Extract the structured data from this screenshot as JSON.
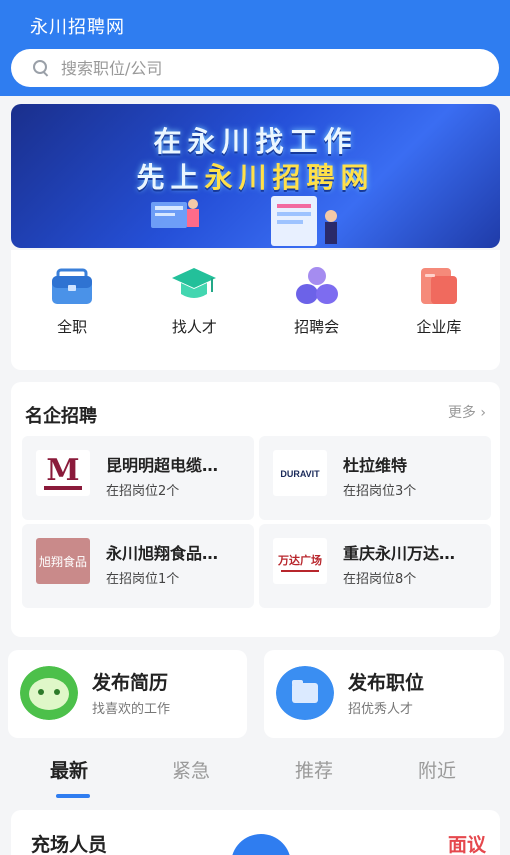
{
  "header": {
    "title": "永川招聘网"
  },
  "search": {
    "placeholder": "搜索职位/公司"
  },
  "banner": {
    "line1": "在永川找工作",
    "line2_prefix": "先上",
    "line2_highlight": "永川招聘网"
  },
  "quick_links": [
    {
      "label": "全职",
      "icon": "briefcase-icon"
    },
    {
      "label": "找人才",
      "icon": "graduation-cap-icon"
    },
    {
      "label": "招聘会",
      "icon": "people-group-icon"
    },
    {
      "label": "企业库",
      "icon": "company-library-icon"
    }
  ],
  "companies": {
    "title": "名企招聘",
    "more": "更多",
    "items": [
      {
        "name": "昆明明超电缆…",
        "count": "在招岗位2个",
        "logo_text": "M"
      },
      {
        "name": "杜拉维特",
        "count": "在招岗位3个",
        "logo_text": "DURAVIT"
      },
      {
        "name": "永川旭翔食品…",
        "count": "在招岗位1个",
        "logo_text": "旭翔食品"
      },
      {
        "name": "重庆永川万达…",
        "count": "在招岗位8个",
        "logo_text": "万达广场"
      }
    ]
  },
  "actions": [
    {
      "title": "发布简历",
      "subtitle": "找喜欢的工作",
      "icon": "smile-face-icon",
      "color": "#4cc04a"
    },
    {
      "title": "发布职位",
      "subtitle": "招优秀人才",
      "icon": "folder-icon",
      "color": "#3a8ef2"
    }
  ],
  "tabs": [
    "最新",
    "紧急",
    "推荐",
    "附近"
  ],
  "job": {
    "title": "充场人员",
    "salary": "面议"
  },
  "colors": {
    "brand": "#2f7df0",
    "salary": "#e5484d"
  }
}
